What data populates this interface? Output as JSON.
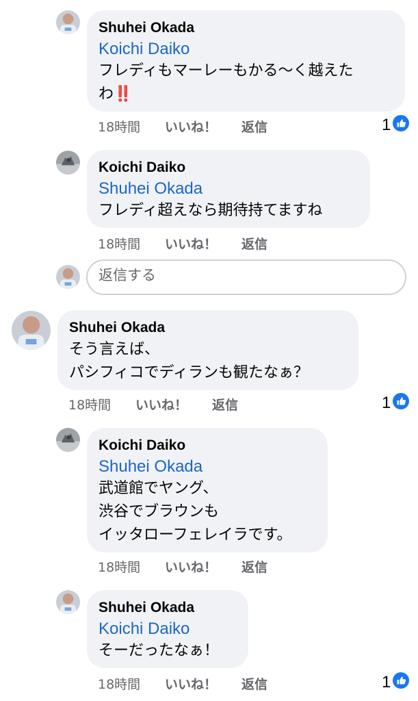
{
  "comments": [
    {
      "author": "Shuhei Okada",
      "mention": "Koichi Daiko",
      "lines": [
        "フレディもマーレーもかる〜く越えた",
        "わ"
      ],
      "emoji": "‼️",
      "time": "18時間",
      "like_label": "いいね！",
      "reply_label": "返信",
      "reaction_count": "1"
    },
    {
      "author": "Koichi Daiko",
      "mention": "Shuhei Okada",
      "lines": [
        "フレディ超えなら期待持てますね"
      ],
      "time": "18時間",
      "like_label": "いいね！",
      "reply_label": "返信"
    },
    {
      "author": "Shuhei Okada",
      "lines": [
        "そう言えば、",
        "パシフィコでディランも観たなぁ？"
      ],
      "time": "18時間",
      "like_label": "いいね！",
      "reply_label": "返信",
      "reaction_count": "1"
    },
    {
      "author": "Koichi Daiko",
      "mention": "Shuhei Okada",
      "lines": [
        "武道館でヤング、",
        "渋谷でブラウンも",
        "イッタローフェレイラです。"
      ],
      "time": "18時間",
      "like_label": "いいね！",
      "reply_label": "返信"
    },
    {
      "author": "Shuhei Okada",
      "mention": "Koichi Daiko",
      "lines": [
        "そーだったなぁ！"
      ],
      "time": "18時間",
      "like_label": "いいね！",
      "reply_label": "返信",
      "reaction_count": "1"
    }
  ],
  "reply_input": {
    "placeholder": "返信する"
  },
  "icons": {
    "reaction": "thumbs-up-icon",
    "avatar_shuhei": "avatar-shuhei-okada",
    "avatar_koichi": "avatar-koichi-daiko"
  },
  "colors": {
    "bubble": "#f0f2f5",
    "mention": "#1b66c9",
    "meta": "#65676b",
    "like_badge": "#1877f2",
    "emoji": "#e2102a"
  }
}
